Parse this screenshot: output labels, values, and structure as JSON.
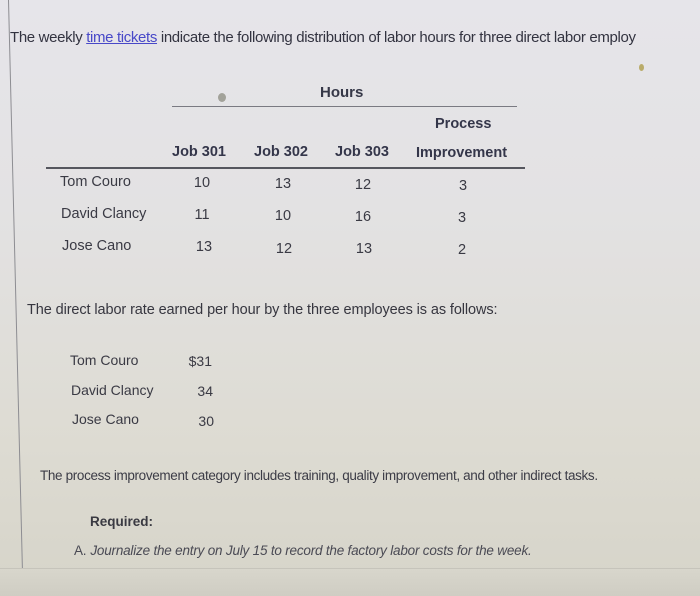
{
  "intro": {
    "before_link": "The weekly ",
    "link_text": "time tickets",
    "after_link": " indicate the following distribution of labor hours for three direct labor employ"
  },
  "hours_table": {
    "group_header": "Hours",
    "columns": [
      "Job 301",
      "Job 302",
      "Job 303",
      "Process Improvement"
    ],
    "process_header_line1": "Process",
    "process_header_line2": "Improvement",
    "rows": [
      {
        "name": "Tom Couro",
        "values": [
          "10",
          "13",
          "12",
          "3"
        ]
      },
      {
        "name": "David Clancy",
        "values": [
          "11",
          "10",
          "16",
          "3"
        ]
      },
      {
        "name": "Jose Cano",
        "values": [
          "13",
          "12",
          "13",
          "2"
        ]
      }
    ]
  },
  "rate_intro": "The direct labor rate earned per hour by the three employees is as follows:",
  "rates": [
    {
      "name": "Tom Couro",
      "rate": "$31"
    },
    {
      "name": "David Clancy",
      "rate": "34"
    },
    {
      "name": "Jose Cano",
      "rate": "30"
    }
  ],
  "note": "The process improvement category includes training, quality improvement, and other indirect tasks.",
  "required": {
    "label": "Required:",
    "tasks": [
      {
        "letter": "A.",
        "text": "Journalize the entry on July 15 to record the factory labor costs for the week."
      }
    ]
  }
}
